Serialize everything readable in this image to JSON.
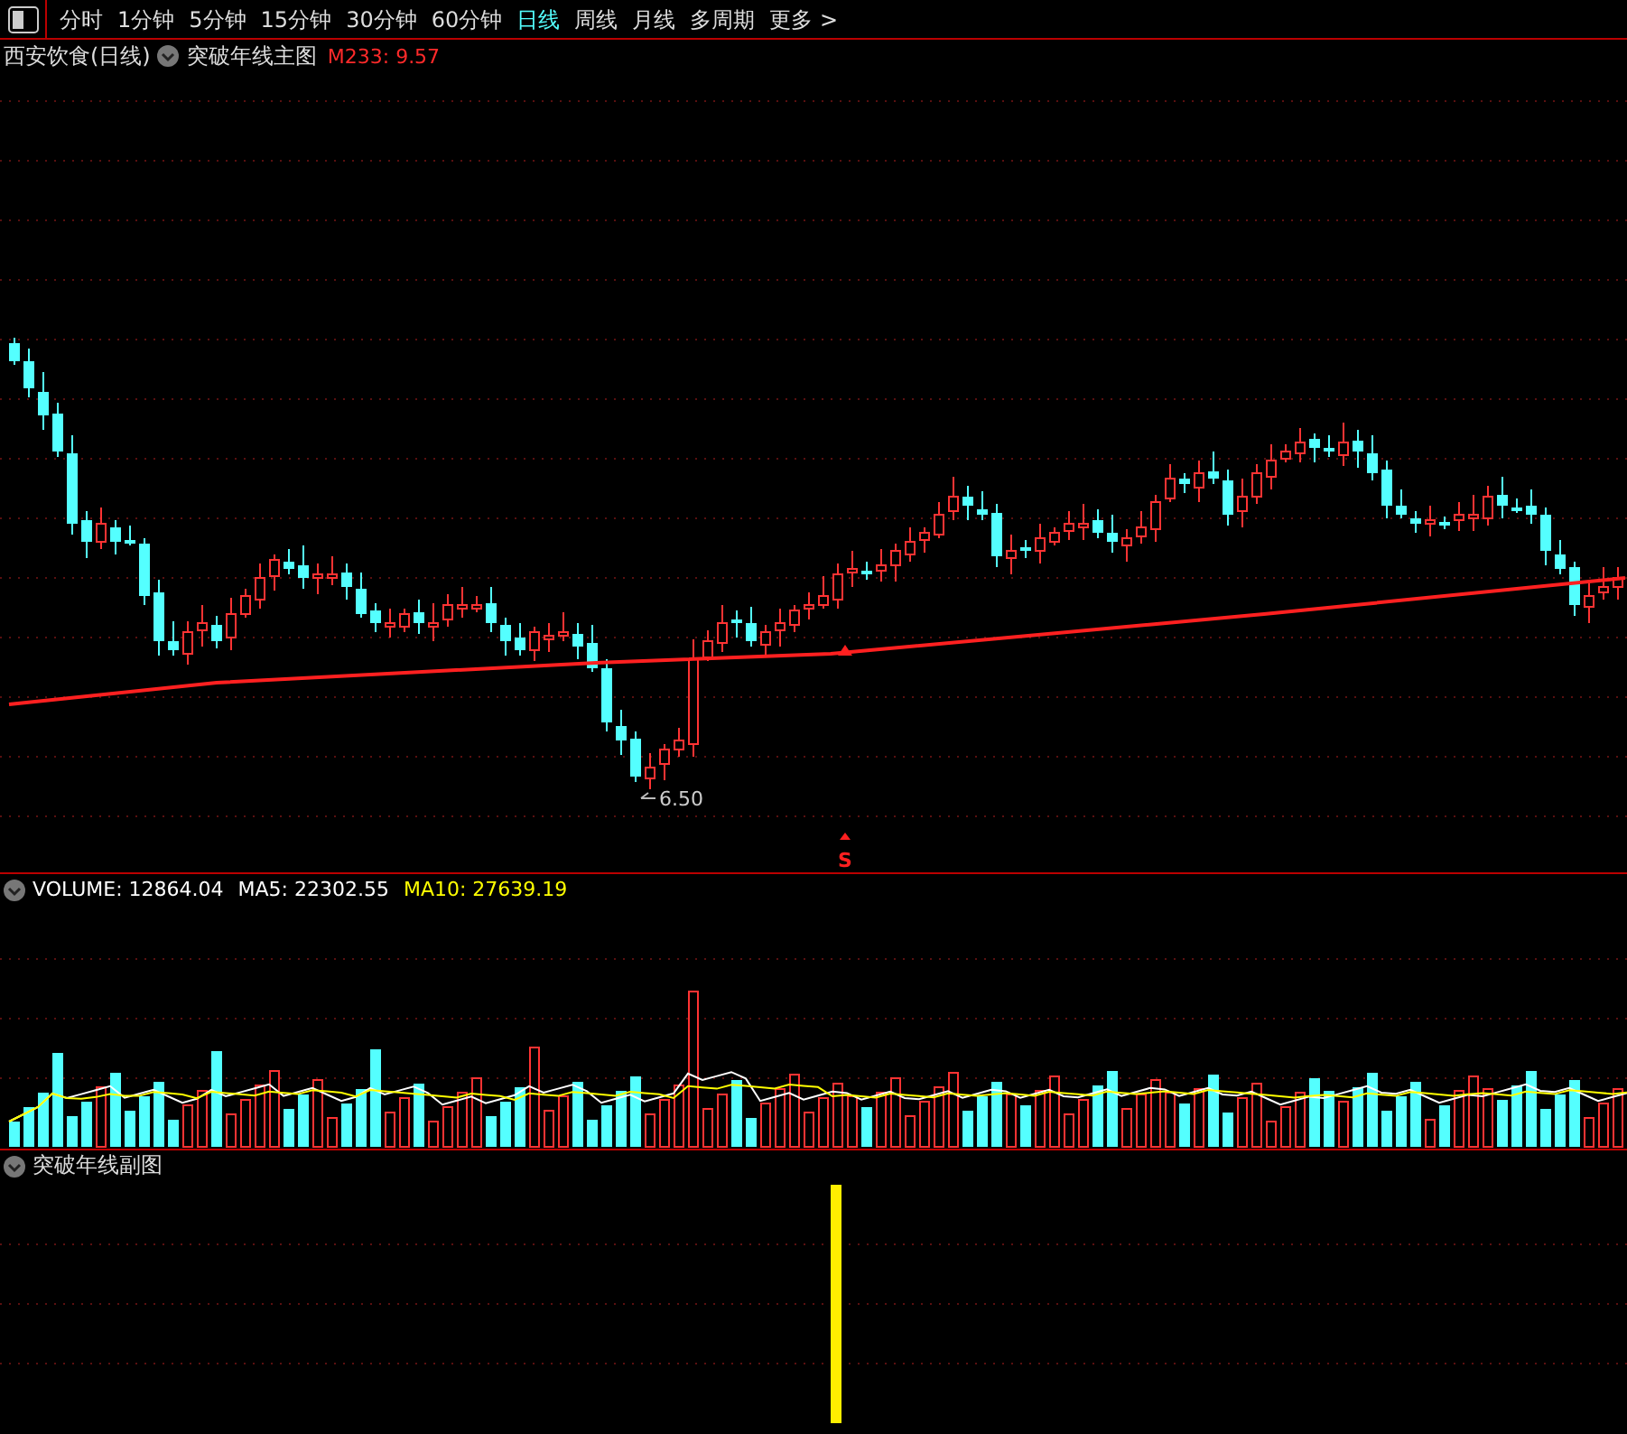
{
  "toolbar": {
    "tabs": [
      {
        "label": "分时",
        "selected": false
      },
      {
        "label": "1分钟",
        "selected": false
      },
      {
        "label": "5分钟",
        "selected": false
      },
      {
        "label": "15分钟",
        "selected": false
      },
      {
        "label": "30分钟",
        "selected": false
      },
      {
        "label": "60分钟",
        "selected": false
      },
      {
        "label": "日线",
        "selected": true
      },
      {
        "label": "周线",
        "selected": false
      },
      {
        "label": "月线",
        "selected": false
      },
      {
        "label": "多周期",
        "selected": false
      }
    ],
    "more": "更多 >"
  },
  "main_chart": {
    "stock_title": "西安饮食(日线)",
    "indicator": "突破年线主图",
    "reading": "M233: 9.57",
    "low_label": "6.50",
    "signal_label": "S"
  },
  "volume_panel": {
    "items": [
      {
        "label": "VOLUME: 12864.04",
        "color": "#ffffff"
      },
      {
        "label": "MA5: 22302.55",
        "color": "#ffffff"
      },
      {
        "label": "MA10: 27639.19",
        "color": "#ffff00"
      }
    ]
  },
  "sub_panel": {
    "indicator": "突破年线副图"
  }
}
